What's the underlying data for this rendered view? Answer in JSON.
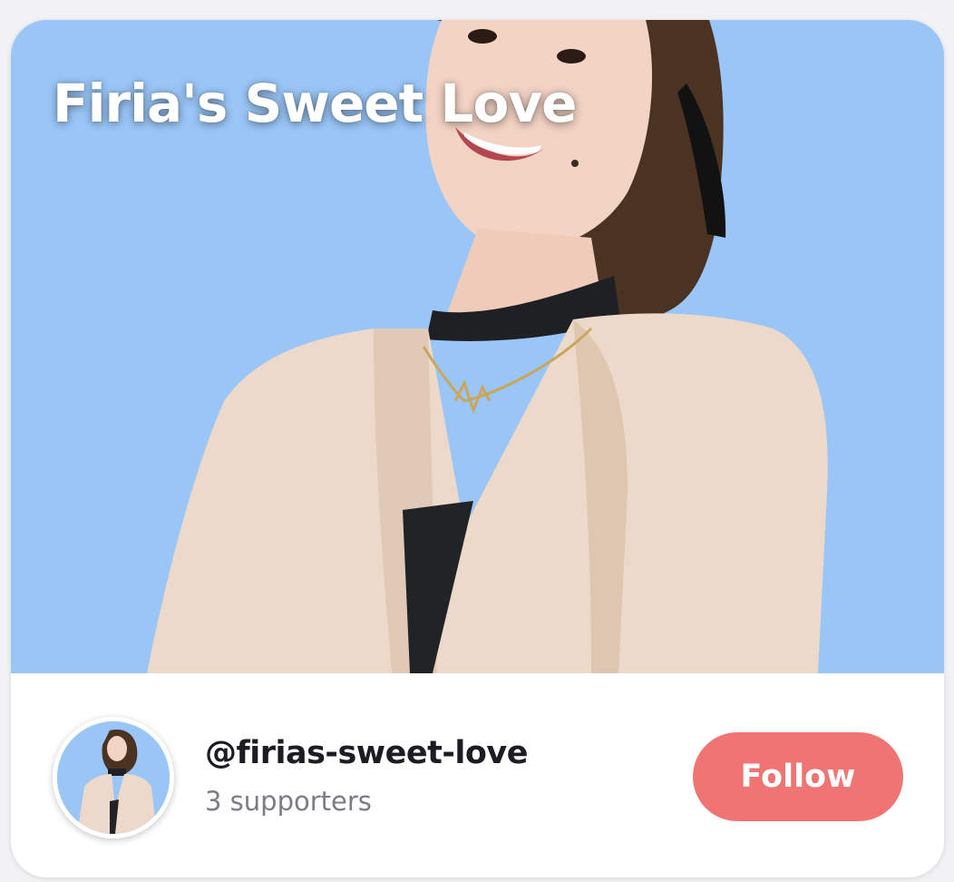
{
  "cover": {
    "title": "Firia's Sweet Love",
    "background_color": "#9ac6f7"
  },
  "profile": {
    "handle": "@firias-sweet-love",
    "supporters": "3 supporters",
    "avatar_icon": "profile-photo"
  },
  "actions": {
    "follow_label": "Follow",
    "follow_color": "#ef7474"
  }
}
